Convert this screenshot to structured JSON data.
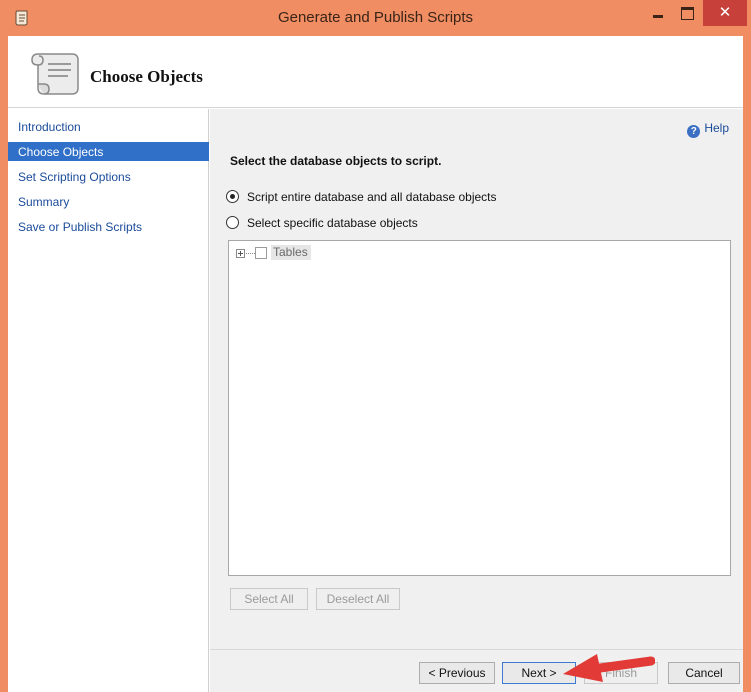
{
  "window": {
    "title": "Generate and Publish Scripts",
    "close_glyph": "✕"
  },
  "header": {
    "title": "Choose Objects",
    "icon": "script-scroll-icon"
  },
  "sidebar": {
    "items": [
      {
        "label": "Introduction"
      },
      {
        "label": "Choose Objects"
      },
      {
        "label": "Set Scripting Options"
      },
      {
        "label": "Summary"
      },
      {
        "label": "Save or Publish Scripts"
      }
    ],
    "active_index": 1
  },
  "main": {
    "help_label": "Help",
    "help_glyph": "?",
    "section_title": "Select the database objects to script.",
    "options": [
      {
        "label": "Script entire database and all database objects",
        "checked": true
      },
      {
        "label": "Select specific database objects",
        "checked": false
      }
    ],
    "tree": {
      "items": [
        {
          "label": "Tables",
          "checked": false,
          "expanded": false
        }
      ]
    },
    "select_all_label": "Select All",
    "deselect_all_label": "Deselect All"
  },
  "footer": {
    "previous_label": "< Previous",
    "next_label": "Next >",
    "finish_label": "Finish",
    "cancel_label": "Cancel"
  },
  "colors": {
    "frame": "#f08d62",
    "close_button": "#c7403a",
    "selected_nav": "#3070c8",
    "link": "#1b4b9a",
    "annotation_arrow": "#e23a36"
  }
}
